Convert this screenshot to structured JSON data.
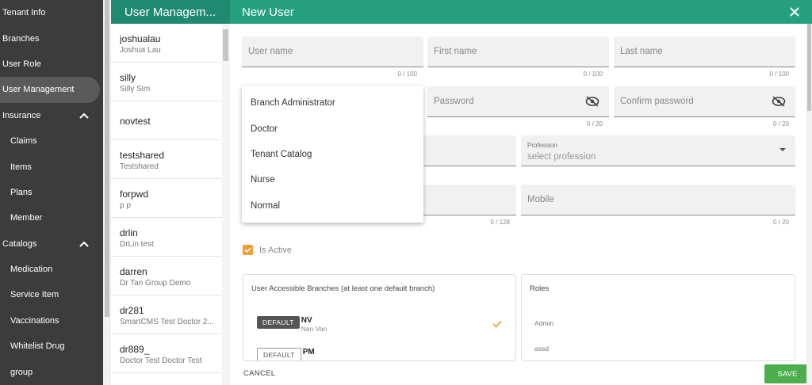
{
  "sidebar": {
    "items": [
      {
        "label": "Tenant Info",
        "sub": false,
        "active": false,
        "chevron": false
      },
      {
        "label": "Branches",
        "sub": false,
        "active": false,
        "chevron": false
      },
      {
        "label": "User Role",
        "sub": false,
        "active": false,
        "chevron": false
      },
      {
        "label": "User Management",
        "sub": false,
        "active": true,
        "chevron": false
      },
      {
        "label": "Insurance",
        "sub": false,
        "active": false,
        "chevron": true
      },
      {
        "label": "Claims",
        "sub": true,
        "active": false,
        "chevron": false
      },
      {
        "label": "Items",
        "sub": true,
        "active": false,
        "chevron": false
      },
      {
        "label": "Plans",
        "sub": true,
        "active": false,
        "chevron": false
      },
      {
        "label": "Member",
        "sub": true,
        "active": false,
        "chevron": false
      },
      {
        "label": "Catalogs",
        "sub": false,
        "active": false,
        "chevron": true
      },
      {
        "label": "Medication",
        "sub": true,
        "active": false,
        "chevron": false
      },
      {
        "label": "Service Item",
        "sub": true,
        "active": false,
        "chevron": false
      },
      {
        "label": "Vaccinations",
        "sub": true,
        "active": false,
        "chevron": false
      },
      {
        "label": "Whitelist Drug",
        "sub": true,
        "active": false,
        "chevron": false
      },
      {
        "label": "group",
        "sub": true,
        "active": false,
        "chevron": false
      }
    ]
  },
  "userlist": {
    "title": "User Managem...",
    "users": [
      {
        "username": "joshualau",
        "name": "Joshua Lau"
      },
      {
        "username": "silly",
        "name": "Silly Sim"
      },
      {
        "username": "novtest",
        "name": ""
      },
      {
        "username": "testshared",
        "name": "Testshared"
      },
      {
        "username": "forpwd",
        "name": "p p"
      },
      {
        "username": "drlin",
        "name": "DrLin test"
      },
      {
        "username": "darren",
        "name": "Dr Tan Group Demo"
      },
      {
        "username": "dr281",
        "name": "SmartCMS Test Doctor 2..."
      },
      {
        "username": "dr889_",
        "name": "Doctor Test Doctor Test"
      }
    ]
  },
  "form": {
    "title": "New User",
    "username_placeholder": "User name",
    "username_counter": "0 / 100",
    "firstname_placeholder": "First name",
    "firstname_counter": "0 / 100",
    "lastname_placeholder": "Last name",
    "lastname_counter": "0 / 100",
    "password_placeholder": "Password",
    "password_counter": "0 / 20",
    "confirm_placeholder": "Confirm password",
    "confirm_counter": "0 / 20",
    "profession_label": "Profession",
    "profession_placeholder": "select profession",
    "email_counter": "0 / 128",
    "mobile_placeholder": "Mobile",
    "mobile_counter": "0 / 20",
    "is_active_label": "Is Active",
    "is_active": true,
    "branches_title": "User Accessible Branches (at least one default branch)",
    "branches": [
      {
        "chip": "DEFAULT",
        "code": "NV",
        "name": "Nan Van",
        "selected": true
      },
      {
        "chip": "DEFAULT",
        "code": "PM",
        "name": "",
        "selected": false
      }
    ],
    "roles_title": "Roles",
    "roles": [
      "Admin",
      "assd"
    ],
    "cancel_label": "CANCEL",
    "save_label": "SAVE"
  },
  "dropdown": {
    "options": [
      "Branch Administrator",
      "Doctor",
      "Tenant Catalog",
      "Nurse",
      "Normal"
    ]
  },
  "colors": {
    "accent": "#26a17f",
    "sidebar_bg": "#3c3c3c",
    "save_button": "#4cae4c",
    "checkbox": "#f0a030"
  }
}
